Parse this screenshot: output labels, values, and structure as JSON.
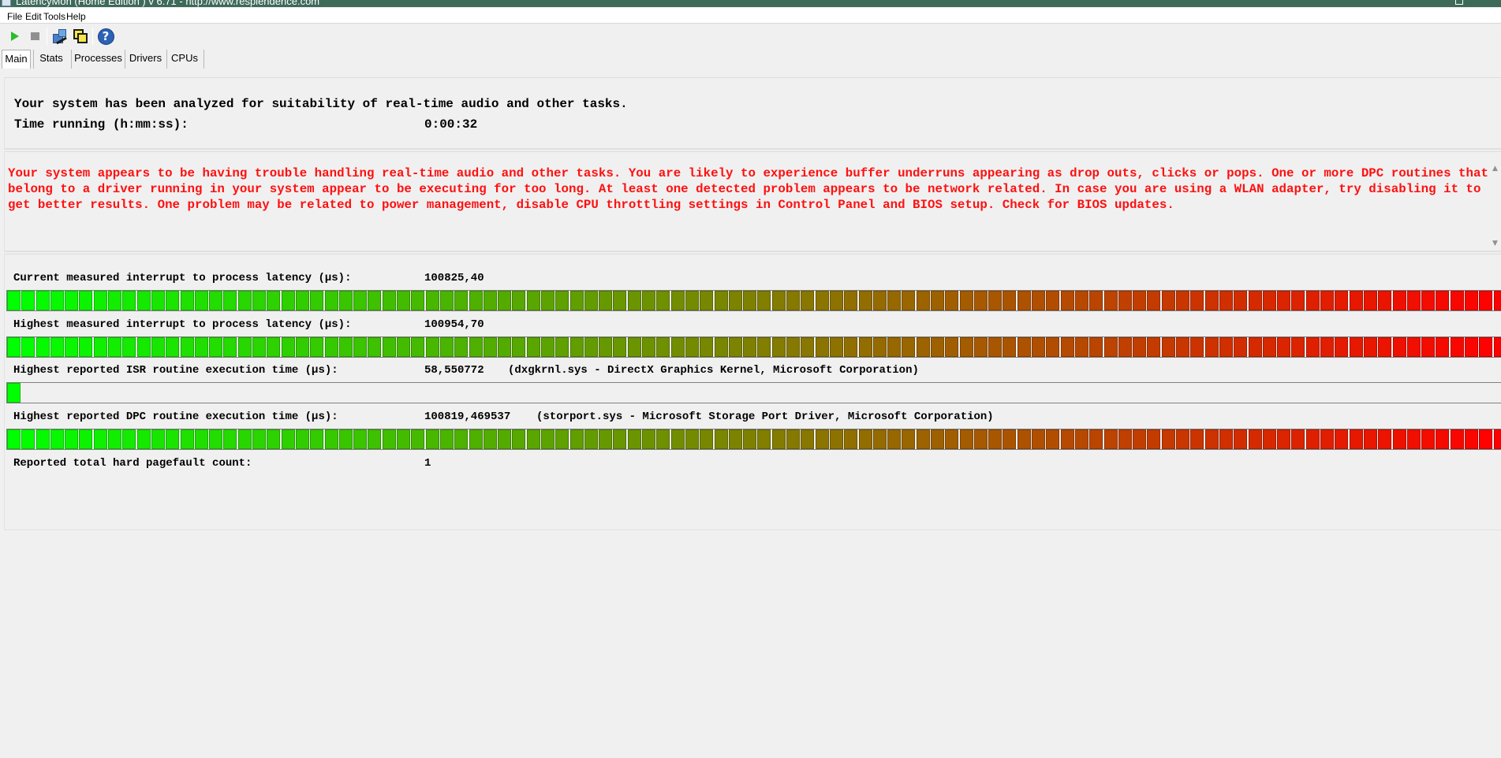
{
  "window": {
    "title": "LatencyMon  (Home Edition )  v 6.71 - http://www.resplendence.com"
  },
  "menu": [
    "File",
    "Edit",
    "Tools",
    "Help"
  ],
  "toolbar": {
    "buttons": [
      "play-icon",
      "stop-icon",
      "driver-icon",
      "cpu-windows-icon",
      "help-icon"
    ],
    "help_glyph": "?"
  },
  "tabs": [
    "Main",
    "Stats",
    "Processes",
    "Drivers",
    "CPUs"
  ],
  "active_tab": "Main",
  "summary": {
    "analyzed_text": "Your system has been analyzed for suitability of real-time audio and other tasks.",
    "time_label": "Time running (h:mm:ss):",
    "time_value": "0:00:32"
  },
  "verdict": {
    "text": "Your system appears to be having trouble handling real-time audio and other tasks. You are likely to experience buffer underruns appearing as drop outs, clicks or pops. One or more DPC routines that belong to a driver running in your system appear to be executing for too long. At least one detected problem appears to be network related. In case you are using a WLAN adapter, try disabling it to get better results. One problem may be related to power management, disable CPU throttling settings in Control Panel and BIOS setup. Check for BIOS updates.",
    "color": "#ff1010"
  },
  "metrics": {
    "current_latency": {
      "label": "Current measured interrupt to process latency (µs):",
      "value": "100825,40",
      "meter_fraction": 1.0
    },
    "highest_latency": {
      "label": "Highest measured interrupt to process latency (µs):",
      "value": "100954,70",
      "meter_fraction": 1.0
    },
    "isr": {
      "label": "Highest reported ISR routine execution time (µs):",
      "value": "58,550772",
      "detail": "(dxgkrnl.sys - DirectX Graphics Kernel, Microsoft Corporation)",
      "meter_fraction": 0.01
    },
    "dpc": {
      "label": "Highest reported DPC routine execution time (µs):",
      "value": "100819,469537",
      "detail": "(storport.sys - Microsoft Storage Port Driver, Microsoft Corporation)",
      "meter_fraction": 1.0
    },
    "pagefault": {
      "label": "Reported total hard pagefault count:",
      "value": "1"
    }
  },
  "colors": {
    "meter_start": "#00ff00",
    "meter_end": "#ff0000"
  }
}
